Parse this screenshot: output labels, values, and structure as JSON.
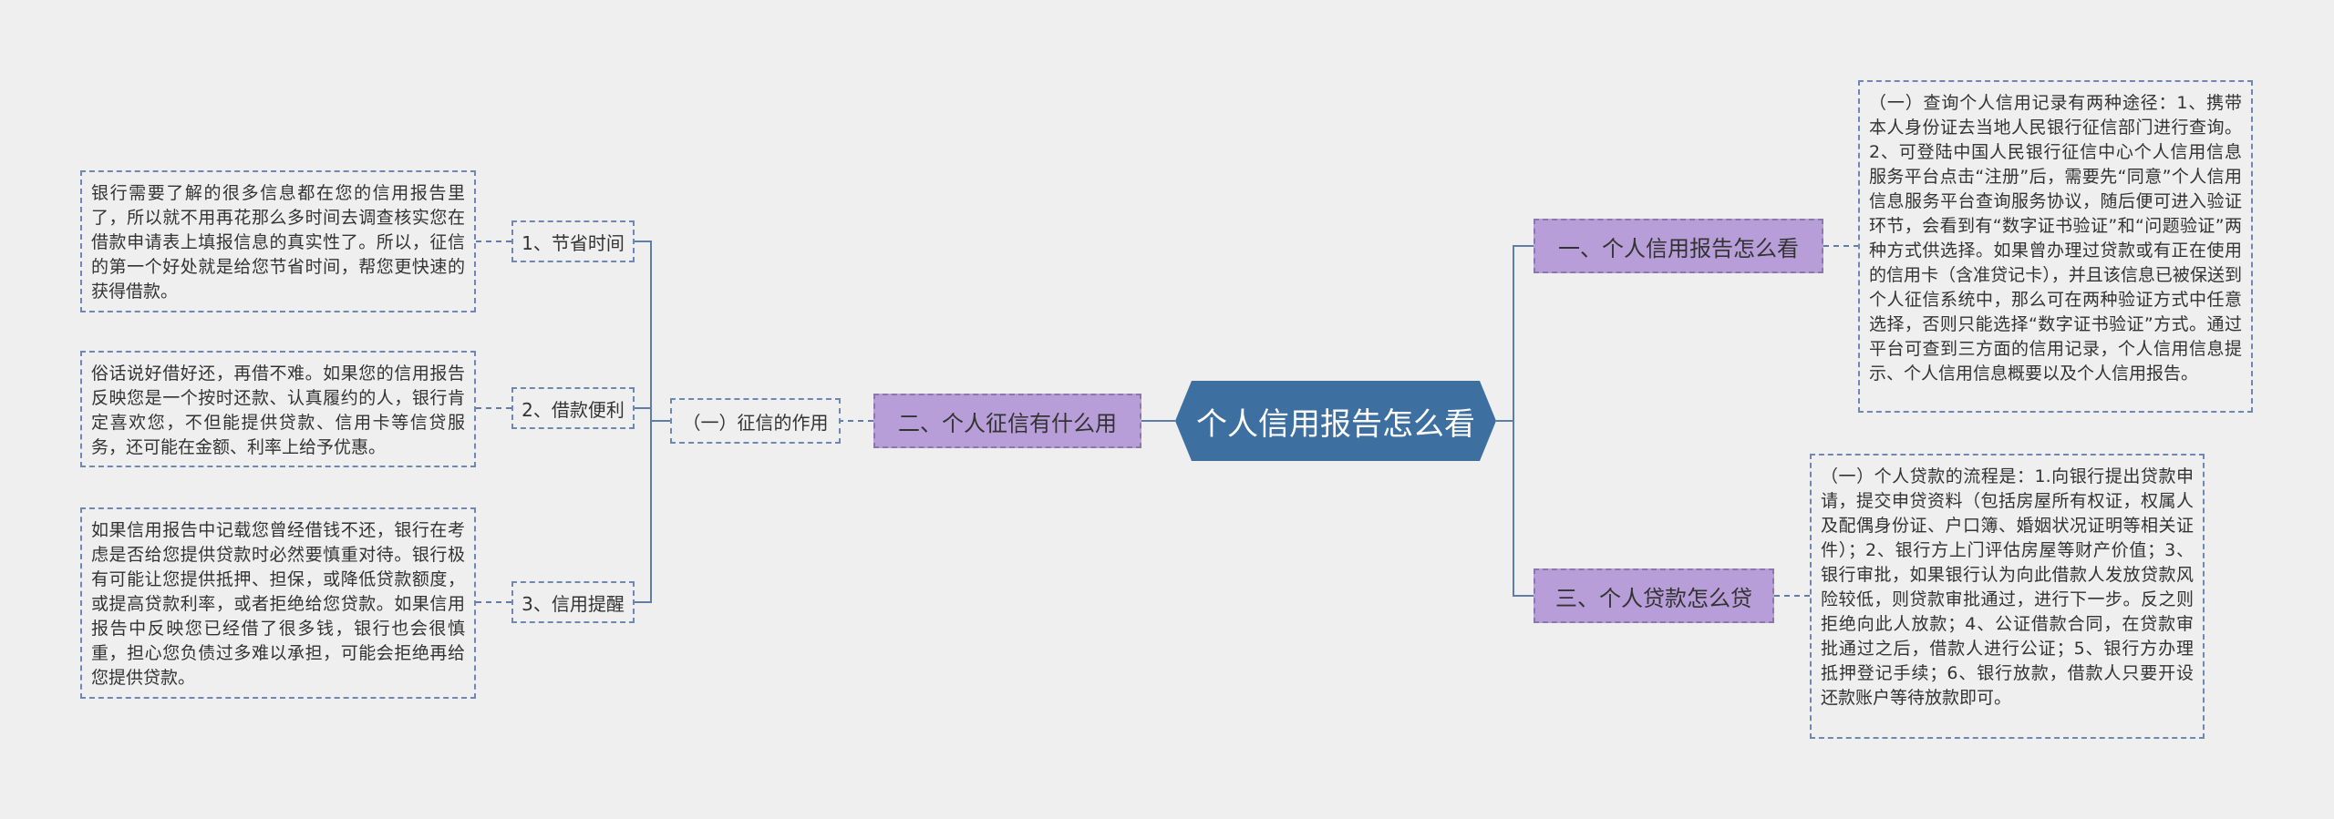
{
  "colors": {
    "root_fill": "#3d6fa0",
    "branch_fill": "#b89ed8",
    "link_line": "#5e7ea8",
    "background": "#efefef"
  },
  "root": {
    "label": "个人信用报告怎么看"
  },
  "right_branches": [
    {
      "label": "一、个人信用报告怎么看",
      "detail": "（一）查询个人信用记录有两种途径：1、携带本人身份证去当地人民银行征信部门进行查询。2、可登陆中国人民银行征信中心个人信用信息服务平台点击“注册”后，需要先“同意”个人信用信息服务平台查询服务协议，随后便可进入验证环节，会看到有“数字证书验证”和“问题验证”两种方式供选择。如果曾办理过贷款或有正在使用的信用卡（含准贷记卡），并且该信息已被保送到个人征信系统中，那么可在两种验证方式中任意选择，否则只能选择“数字证书验证”方式。通过平台可查到三方面的信用记录，个人信用信息提示、个人信用信息概要以及个人信用报告。"
    },
    {
      "label": "三、个人贷款怎么贷",
      "detail": "（一）个人贷款的流程是：1.向银行提出贷款申请，提交申贷资料（包括房屋所有权证，权属人及配偶身份证、户口簿、婚姻状况证明等相关证件）；2、银行方上门评估房屋等财产价值；3、银行审批，如果银行认为向此借款人发放贷款风险较低，则贷款审批通过，进行下一步。反之则拒绝向此人放款；4、公证借款合同，在贷款审批通过之后，借款人进行公证；5、银行方办理抵押登记手续；6、银行放款，借款人只要开设还款账户等待放款即可。"
    }
  ],
  "left_branch": {
    "label": "二、个人征信有什么用",
    "sub": {
      "label": "（一）征信的作用"
    },
    "items": [
      {
        "label": "1、节省时间",
        "detail": "银行需要了解的很多信息都在您的信用报告里了，所以就不用再花那么多时间去调查核实您在借款申请表上填报信息的真实性了。所以，征信的第一个好处就是给您节省时间，帮您更快速的获得借款。"
      },
      {
        "label": "2、借款便利",
        "detail": "俗话说好借好还，再借不难。如果您的信用报告反映您是一个按时还款、认真履约的人，银行肯定喜欢您，不但能提供贷款、信用卡等信贷服务，还可能在金额、利率上给予优惠。"
      },
      {
        "label": "3、信用提醒",
        "detail": "如果信用报告中记载您曾经借钱不还，银行在考虑是否给您提供贷款时必然要慎重对待。银行极有可能让您提供抵押、担保，或降低贷款额度，或提高贷款利率，或者拒绝给您贷款。如果信用报告中反映您已经借了很多钱，银行也会很慎重，担心您负债过多难以承担，可能会拒绝再给您提供贷款。"
      }
    ]
  }
}
